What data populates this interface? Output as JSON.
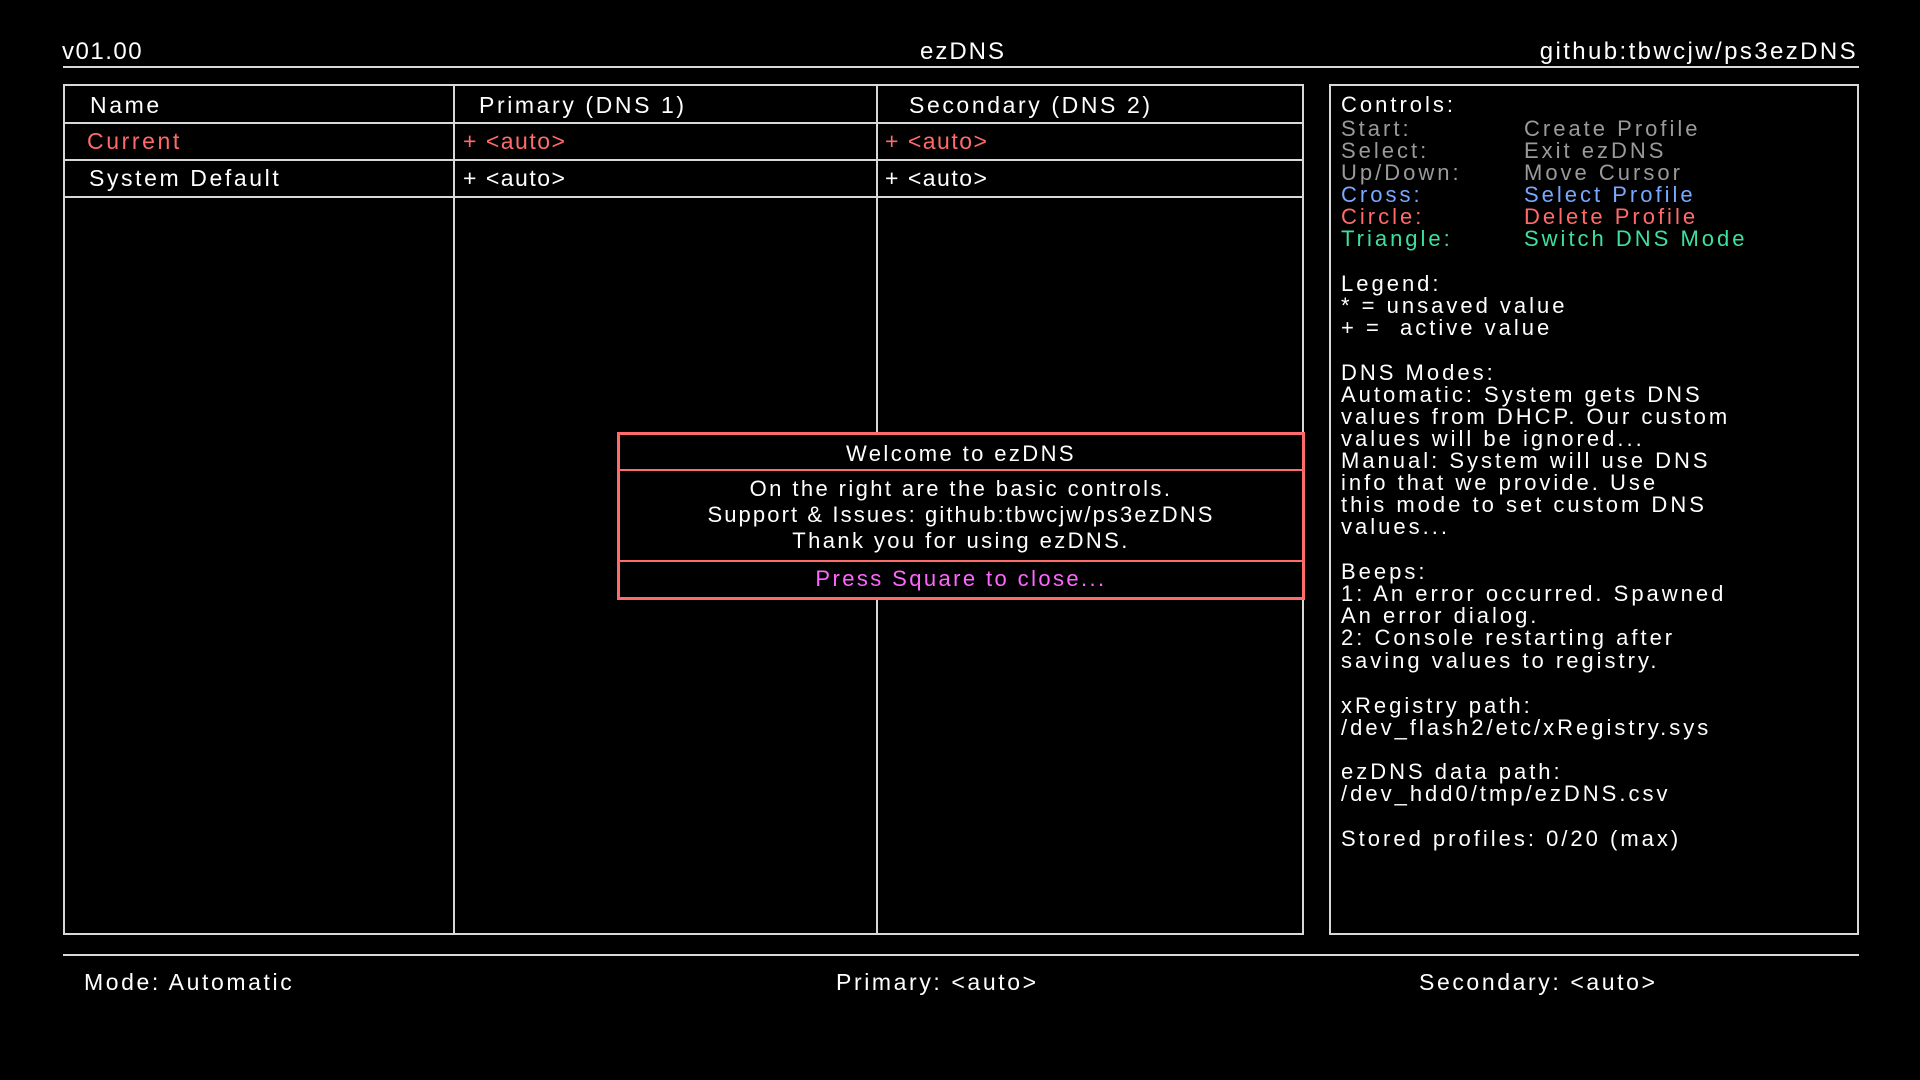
{
  "header": {
    "version": "v01.00",
    "title": "ezDNS",
    "repo": "github:tbwcjw/ps3ezDNS"
  },
  "table": {
    "columns": [
      "Name",
      "Primary (DNS 1)",
      "Secondary (DNS 2)"
    ],
    "rows": [
      {
        "name": "Current",
        "primary": "+ <auto>",
        "secondary": "+ <auto>"
      },
      {
        "name": "System Default",
        "primary": "+ <auto>",
        "secondary": "+ <auto>"
      }
    ]
  },
  "controls": {
    "title": "Controls:",
    "items": [
      {
        "button": "Start:",
        "action": "Create Profile"
      },
      {
        "button": "Select:",
        "action": "Exit ezDNS"
      },
      {
        "button": "Up/Down:",
        "action": "Move Cursor"
      },
      {
        "button": "Cross:",
        "action": "Select Profile"
      },
      {
        "button": "Circle:",
        "action": "Delete Profile"
      },
      {
        "button": "Triangle:",
        "action": "Switch DNS Mode"
      }
    ],
    "legend_title": "Legend:",
    "legend_lines": [
      "* = unsaved value",
      "+ =  active value"
    ],
    "modes_title": "DNS Modes:",
    "modes_lines": [
      "Automatic: System gets DNS",
      "values from DHCP. Our custom",
      "values will be ignored...",
      "Manual: System will use DNS",
      "info that we provide. Use",
      "this mode to set custom DNS",
      "values..."
    ],
    "beeps_title": "Beeps:",
    "beeps_lines": [
      "1: An error occurred. Spawned",
      "An error dialog.",
      "2: Console restarting after",
      "saving values to registry."
    ],
    "xregistry_title": "xRegistry path:",
    "xregistry_path": "/dev_flash2/etc/xRegistry.sys",
    "data_title": "ezDNS data path:",
    "data_path": "/dev_hdd0/tmp/ezDNS.csv",
    "stored": "Stored profiles: 0/20 (max)"
  },
  "dialog": {
    "title": "Welcome to ezDNS",
    "lines": [
      "On the right are the basic controls.",
      "Support & Issues: github:tbwcjw/ps3ezDNS",
      "Thank you for using ezDNS."
    ],
    "close": "Press Square to close..."
  },
  "status": {
    "mode": "Mode: Automatic",
    "primary": "Primary: <auto>",
    "secondary": "Secondary: <auto>"
  },
  "colors": {
    "background": "#000000",
    "text": "#ffffff",
    "highlight": "#ff6b6b",
    "muted": "#9a9a9a",
    "cross": "#78a8ff",
    "triangle": "#3ee0a0",
    "dialog_prompt": "#ff66ff"
  }
}
